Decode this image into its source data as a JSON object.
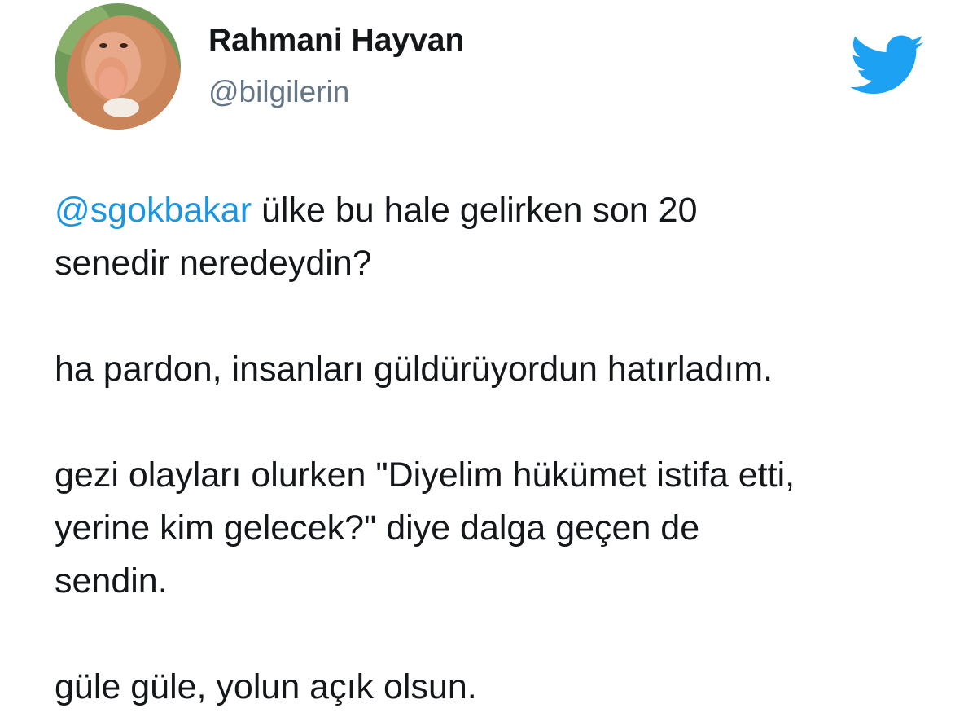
{
  "author": {
    "display_name": "Rahmani Hayvan",
    "username": "@bilgilerin",
    "avatar": "proboscis-monkey-avatar"
  },
  "brand": {
    "icon": "twitter-bird-icon",
    "color": "#1da1f2"
  },
  "tweet": {
    "mention": "@sgokbakar",
    "line1_rest": " ülke bu hale gelirken son 20",
    "line2": "senedir neredeydin?",
    "para2": "ha pardon, insanları güldürüyordun hatırladım.",
    "para3_line1": "gezi olayları olurken \"Diyelim hükümet istifa etti,",
    "para3_line2": "yerine kim gelecek?\" diye dalga geçen de",
    "para3_line3": "sendin.",
    "para4": "güle güle, yolun açık olsun."
  },
  "colors": {
    "text": "#14171a",
    "secondary_text": "#657786",
    "link": "#1b95e0"
  }
}
